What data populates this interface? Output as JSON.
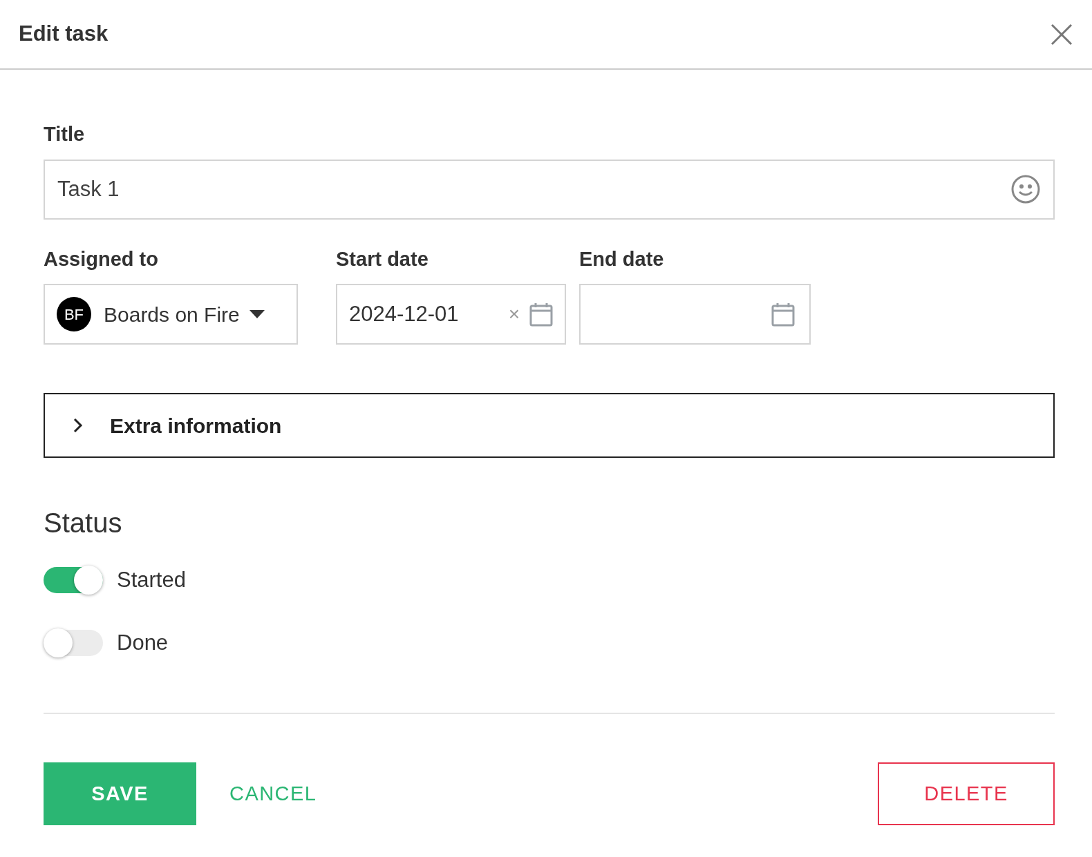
{
  "dialog": {
    "title": "Edit task"
  },
  "title_field": {
    "label": "Title",
    "value": "Task 1"
  },
  "assigned": {
    "label": "Assigned to",
    "initials": "BF",
    "value": "Boards on Fire"
  },
  "start_date": {
    "label": "Start date",
    "value": "2024-12-01",
    "clear": "×"
  },
  "end_date": {
    "label": "End date"
  },
  "extra": {
    "label": "Extra information",
    "expanded": false
  },
  "status": {
    "heading": "Status",
    "toggles": [
      {
        "label": "Started",
        "on": true
      },
      {
        "label": "Done",
        "on": false
      }
    ]
  },
  "buttons": {
    "save": "SAVE",
    "cancel": "CANCEL",
    "delete": "DELETE"
  }
}
